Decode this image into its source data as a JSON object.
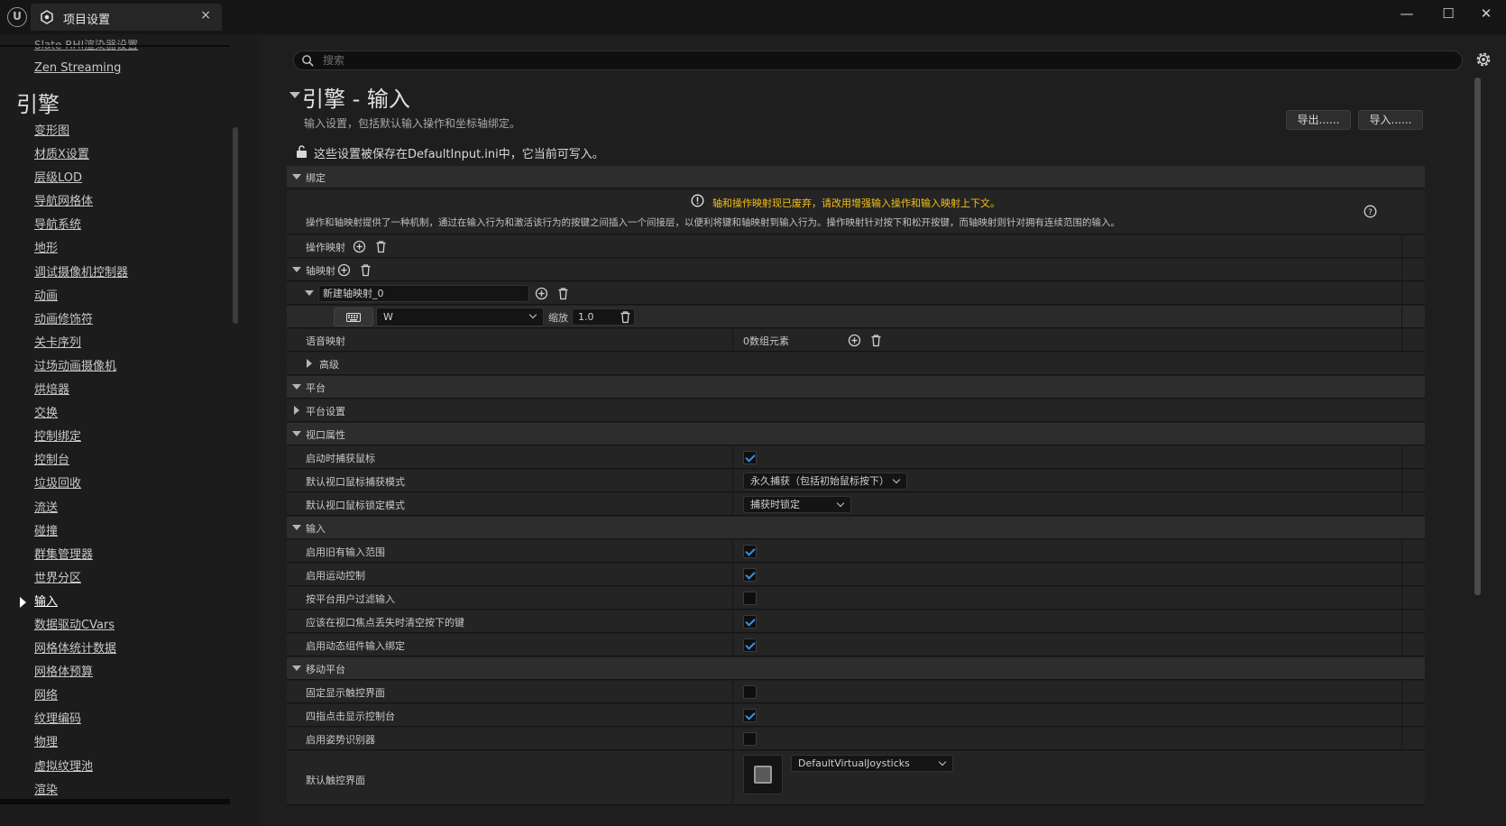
{
  "window": {
    "tab_title": "项目设置",
    "tab_close": "×",
    "min": "—",
    "max": "☐",
    "close": "✕"
  },
  "sidebar": {
    "cut_item": "Slate RHI渲染器设置",
    "zen_item": "Zen Streaming",
    "heading": "引擎",
    "items": [
      {
        "label": "变形图"
      },
      {
        "label": "材质X设置"
      },
      {
        "label": "层级LOD"
      },
      {
        "label": "导航网格体"
      },
      {
        "label": "导航系统"
      },
      {
        "label": "地形"
      },
      {
        "label": "调试摄像机控制器"
      },
      {
        "label": "动画"
      },
      {
        "label": "动画修饰符"
      },
      {
        "label": "关卡序列"
      },
      {
        "label": "过场动画摄像机"
      },
      {
        "label": "烘焙器"
      },
      {
        "label": "交换"
      },
      {
        "label": "控制绑定"
      },
      {
        "label": "控制台"
      },
      {
        "label": "垃圾回收"
      },
      {
        "label": "流送"
      },
      {
        "label": "碰撞"
      },
      {
        "label": "群集管理器"
      },
      {
        "label": "世界分区"
      },
      {
        "label": "输入",
        "active": true
      },
      {
        "label": "数据驱动CVars"
      },
      {
        "label": "网格体统计数据"
      },
      {
        "label": "网格体预算"
      },
      {
        "label": "网络"
      },
      {
        "label": "纹理编码"
      },
      {
        "label": "物理"
      },
      {
        "label": "虚拟纹理池"
      },
      {
        "label": "渲染"
      }
    ]
  },
  "search": {
    "placeholder": "搜索"
  },
  "page": {
    "title": "引擎 - 输入",
    "description": "输入设置，包括默认输入操作和坐标轴绑定。",
    "export_label": "导出......",
    "import_label": "导入......",
    "save_note": "这些设置被保存在DefaultInput.ini中，它当前可写入。"
  },
  "bindings": {
    "category": "绑定",
    "warning": "轴和操作映射现已废弃，请改用增强输入操作和输入映射上下文。",
    "description": "操作和轴映射提供了一种机制，通过在输入行为和激活该行为的按键之间插入一个间接层，以便利将键和轴映射到输入行为。操作映射针对按下和松开按键，而轴映射则针对拥有连续范围的输入。",
    "action_mappings": "操作映射",
    "axis_mappings": "轴映射",
    "axis_name": "新建轴映射_0",
    "key_value": "W",
    "scale_label": "缩放",
    "scale_value": "1.0",
    "speech_mappings": "语音映射",
    "speech_count": "0数组元素",
    "advanced": "高级"
  },
  "platform": {
    "category": "平台",
    "settings": "平台设置"
  },
  "viewport": {
    "category": "视口属性",
    "rows": [
      {
        "label": "启动时捕获鼠标",
        "checked": true
      },
      {
        "label": "默认视口鼠标捕获模式",
        "value": "永久捕获（包括初始鼠标按下）"
      },
      {
        "label": "默认视口鼠标锁定模式",
        "value": "捕获时锁定"
      }
    ]
  },
  "input": {
    "category": "输入",
    "rows": [
      {
        "label": "启用旧有输入范围",
        "checked": true
      },
      {
        "label": "启用运动控制",
        "checked": true
      },
      {
        "label": "按平台用户过滤输入",
        "checked": false
      },
      {
        "label": "应该在视口焦点丢失时清空按下的键",
        "checked": true
      },
      {
        "label": "启用动态组件输入绑定",
        "checked": true
      }
    ]
  },
  "mobile": {
    "category": "移动平台",
    "rows": [
      {
        "label": "固定显示触控界面",
        "checked": false
      },
      {
        "label": "四指点击显示控制台",
        "checked": true
      },
      {
        "label": "启用姿势识别器",
        "checked": false
      }
    ],
    "touch_label": "默认触控界面",
    "touch_value": "DefaultVirtualJoysticks"
  },
  "colors": {
    "accent": "#3d8fe6",
    "warning": "#f2c01a"
  }
}
